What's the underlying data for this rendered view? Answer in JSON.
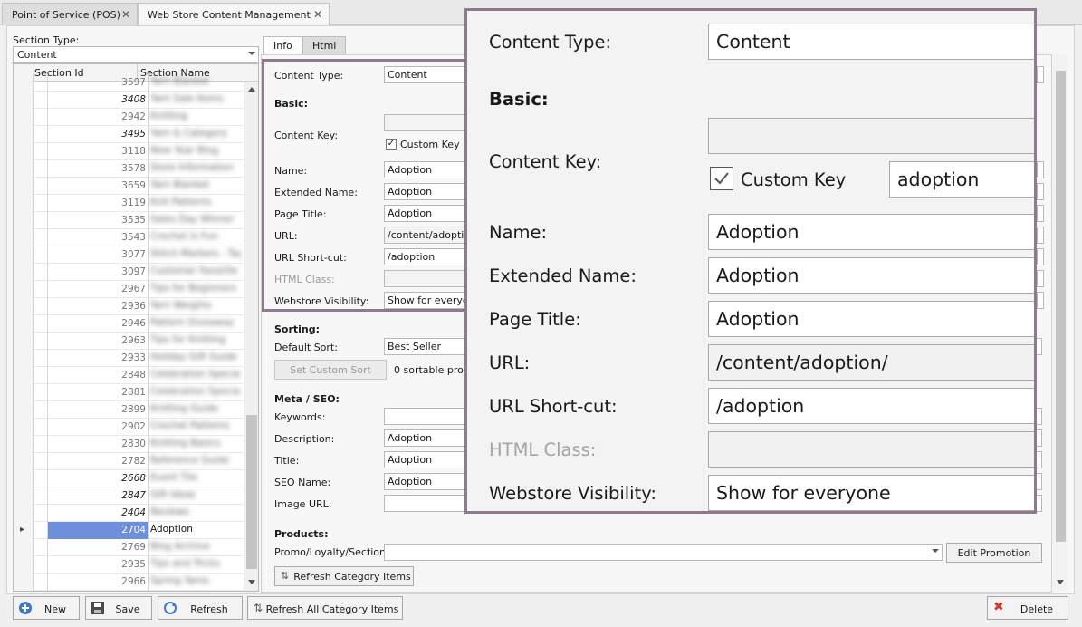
{
  "tabs": [
    {
      "label": "Point of Service (POS)"
    },
    {
      "label": "Web Store Content Management"
    }
  ],
  "left": {
    "section_type_label": "Section Type:",
    "section_type_value": "Content",
    "col_id": "Section Id",
    "col_name": "Section Name",
    "rows": [
      {
        "id": "3597",
        "name": "Yarn Blanket",
        "italic": false
      },
      {
        "id": "3408",
        "name": "Yarn Sale Items",
        "italic": true
      },
      {
        "id": "2942",
        "name": "Knitting",
        "italic": false
      },
      {
        "id": "3495",
        "name": "Yarn & Category",
        "italic": true
      },
      {
        "id": "3118",
        "name": "New Year Blog",
        "italic": false
      },
      {
        "id": "3578",
        "name": "Store Information",
        "italic": false
      },
      {
        "id": "3659",
        "name": "Yarn Blanket",
        "italic": false
      },
      {
        "id": "3119",
        "name": "Knit Patterns",
        "italic": false
      },
      {
        "id": "3535",
        "name": "Sales Day Winner",
        "italic": false
      },
      {
        "id": "3543",
        "name": "Crochet Is Fun",
        "italic": false
      },
      {
        "id": "3077",
        "name": "Stitch Markers - Tag",
        "italic": false
      },
      {
        "id": "3097",
        "name": "Customer Favorite",
        "italic": false
      },
      {
        "id": "2967",
        "name": "Tips for Beginners",
        "italic": false
      },
      {
        "id": "2936",
        "name": "Yarn Weights",
        "italic": false
      },
      {
        "id": "2946",
        "name": "Pattern Giveaway",
        "italic": false
      },
      {
        "id": "2963",
        "name": "Tips for Knitting",
        "italic": false
      },
      {
        "id": "2933",
        "name": "Holiday Gift Guide",
        "italic": false
      },
      {
        "id": "2848",
        "name": "Celebration Specials",
        "italic": false
      },
      {
        "id": "2881",
        "name": "Celebration Specials",
        "italic": false
      },
      {
        "id": "2899",
        "name": "Knitting Guide",
        "italic": false
      },
      {
        "id": "2902",
        "name": "Crochet Patterns",
        "italic": false
      },
      {
        "id": "2830",
        "name": "Knitting Basics",
        "italic": false
      },
      {
        "id": "2782",
        "name": "Reference Guide",
        "italic": false
      },
      {
        "id": "2668",
        "name": "Event Tile",
        "italic": true
      },
      {
        "id": "2847",
        "name": "Gift Ideas",
        "italic": true
      },
      {
        "id": "2404",
        "name": "Reviews",
        "italic": true
      },
      {
        "id": "2704",
        "name": "Adoption",
        "italic": false,
        "selected": true
      },
      {
        "id": "2769",
        "name": "Blog Archive",
        "italic": false
      },
      {
        "id": "2935",
        "name": "Tips and Tricks",
        "italic": false
      },
      {
        "id": "2966",
        "name": "Spring Yarns",
        "italic": false
      }
    ]
  },
  "right": {
    "tab_info": "Info",
    "tab_html": "Html",
    "content_type_label": "Content Type:",
    "content_type_value": "Content",
    "basic_label": "Basic:",
    "content_key_label": "Content Key:",
    "custom_key_label": "Custom Key",
    "custom_key_value": "adoption",
    "name_label": "Name:",
    "name_value": "Adoption",
    "extended_name_label": "Extended Name:",
    "extended_name_value": "Adoption",
    "page_title_label": "Page Title:",
    "page_title_value": "Adoption",
    "url_label": "URL:",
    "url_value": "/content/adoption/",
    "url_short_label": "URL Short-cut:",
    "url_short_value": "/adoption",
    "html_class_label": "HTML Class:",
    "visibility_label": "Webstore Visibility:",
    "visibility_value": "Show for everyone",
    "sorting_label": "Sorting:",
    "default_sort_label": "Default Sort:",
    "default_sort_value": "Best Seller",
    "set_custom_sort": "Set Custom Sort",
    "sortable_text": "0 sortable prod",
    "meta_label": "Meta / SEO:",
    "keywords_label": "Keywords:",
    "description_label": "Description:",
    "description_value": "Adoption",
    "title_label": "Title:",
    "title_value": "Adoption",
    "seo_name_label": "SEO Name:",
    "seo_name_value": "Adoption",
    "image_url_label": "Image URL:",
    "products_label": "Products:",
    "promo_label": "Promo/Loyalty/Section:",
    "edit_promotion": "Edit Promotion",
    "refresh_category_items": "Refresh Category Items"
  },
  "toolbar": {
    "new": "New",
    "save": "Save",
    "refresh": "Refresh",
    "refresh_all": "Refresh All Category Items",
    "delete": "Delete"
  },
  "icons": [
    "close-icon",
    "dropdown-arrow-icon",
    "scroll-up-icon",
    "scroll-down-icon",
    "row-pointer-icon",
    "checkmark-icon",
    "add-icon",
    "save-icon",
    "refresh-icon",
    "sort-arrows-icon",
    "delete-icon"
  ],
  "colors": {
    "selection": "#6e8fdc",
    "zoom_border": "#8f7a8d",
    "delete_red": "#d03a2c",
    "new_blue": "#3f79c8"
  }
}
